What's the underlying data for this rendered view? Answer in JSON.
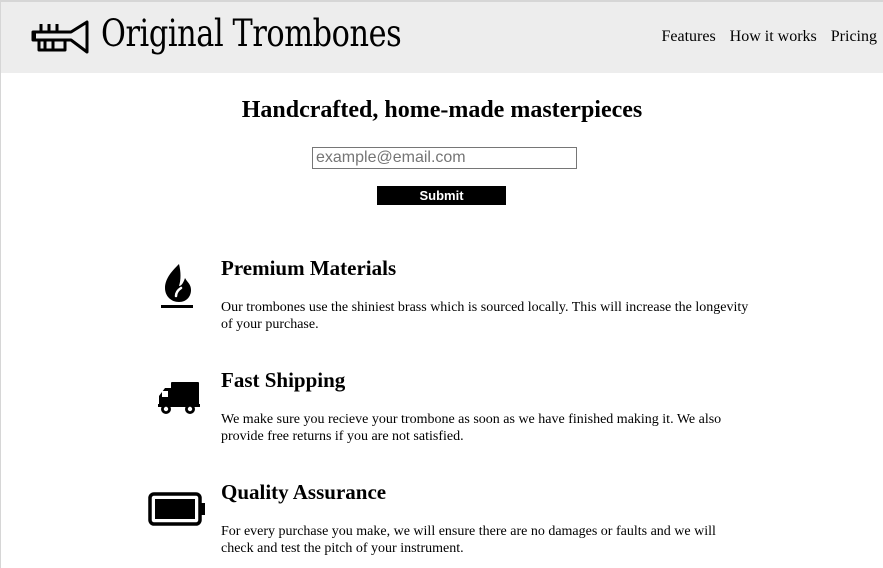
{
  "header": {
    "logo_text": "Original Trombones",
    "logo_icon": "trombone-icon",
    "nav": [
      {
        "label": "Features"
      },
      {
        "label": "How it works"
      },
      {
        "label": "Pricing"
      }
    ]
  },
  "hero": {
    "title": "Handcrafted, home-made masterpieces",
    "email_placeholder": "example@email.com",
    "submit_label": "Submit"
  },
  "features": [
    {
      "icon": "fire-icon",
      "title": "Premium Materials",
      "description": "Our trombones use the shiniest brass which is sourced locally. This will increase the longevity of your purchase."
    },
    {
      "icon": "truck-icon",
      "title": "Fast Shipping",
      "description": "We make sure you recieve your trombone as soon as we have finished making it. We also provide free returns if you are not satisfied."
    },
    {
      "icon": "battery-full-icon",
      "title": "Quality Assurance",
      "description": "For every purchase you make, we will ensure there are no damages or faults and we will check and test the pitch of your instrument."
    }
  ],
  "colors": {
    "header_bg": "#ededed",
    "button_bg": "#000000",
    "button_text": "#ffffff"
  }
}
